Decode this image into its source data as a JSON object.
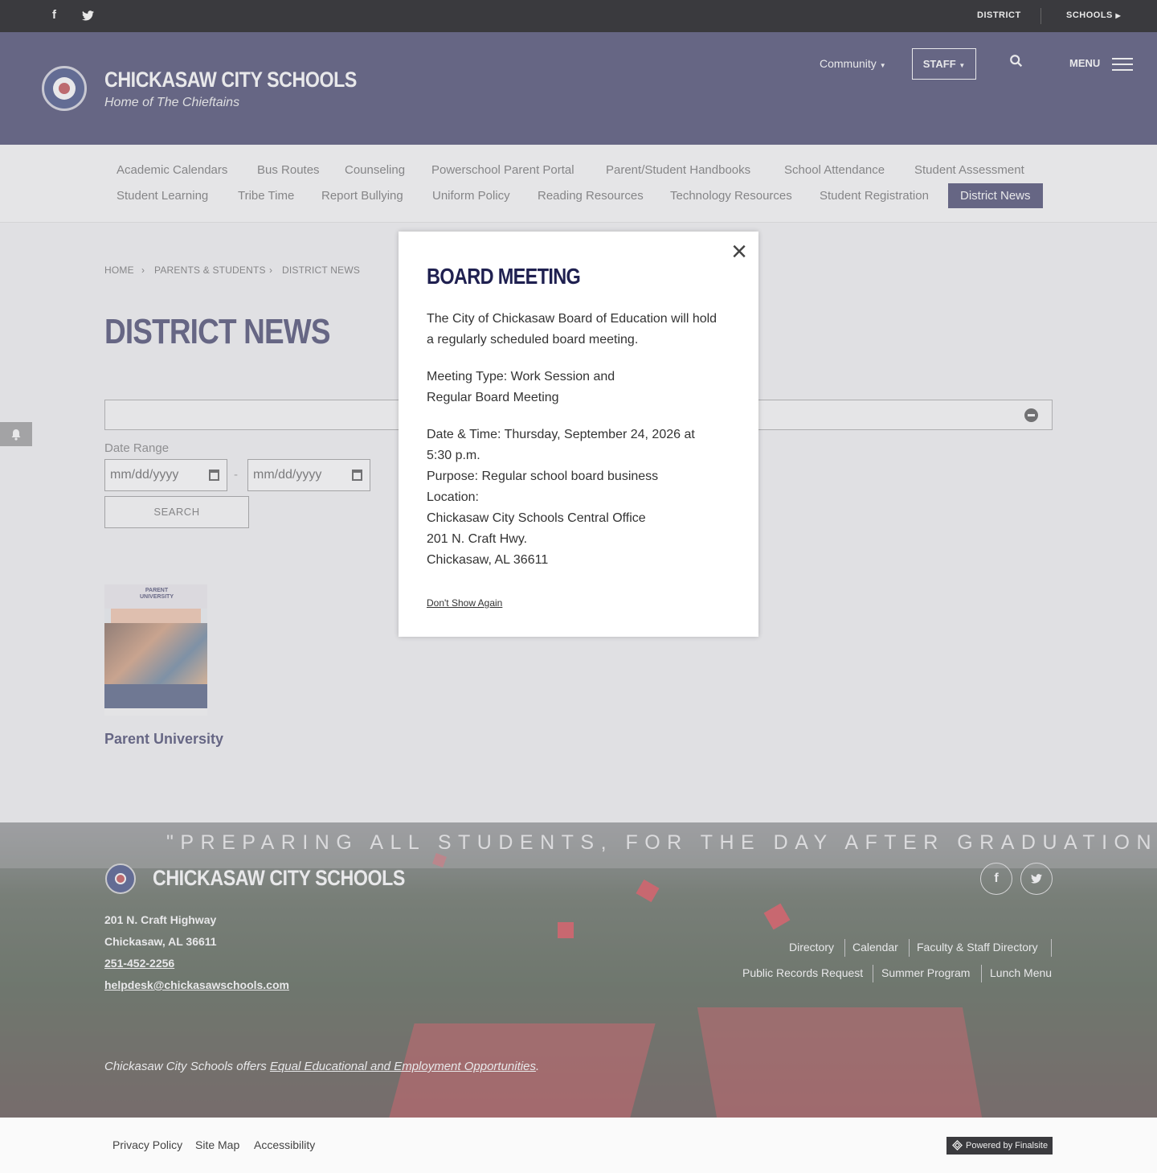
{
  "topbar": {
    "district": "DISTRICT",
    "schools": "SCHOOLS"
  },
  "header": {
    "title": "CHICKASAW CITY SCHOOLS",
    "subtitle": "Home of The Chieftains",
    "community": "Community",
    "staff": "STAFF",
    "menu": "MENU"
  },
  "subnav": [
    "Academic Calendars",
    "Bus Routes",
    "Counseling",
    "Powerschool Parent Portal",
    "Parent/Student Handbooks",
    "School Attendance",
    "Student Assessment",
    "Student Learning",
    "Tribe Time",
    "Report Bullying",
    "Uniform Policy",
    "Reading Resources",
    "Technology Resources",
    "Student Registration",
    "District News"
  ],
  "breadcrumb": [
    "HOME",
    "PARENTS & STUDENTS",
    "DISTRICT NEWS"
  ],
  "page_title": "DISTRICT NEWS",
  "filter": {
    "date_range_label": "Date Range",
    "start_placeholder": "mm/dd/yyyy",
    "end_placeholder": "mm/dd/yyyy",
    "dash": "-",
    "search": "SEARCH"
  },
  "news_item": {
    "title": "Parent University",
    "thumb_heading": "PARENT UNIVERSITY"
  },
  "modal": {
    "close": "×",
    "title": "BOARD MEETING",
    "lines": [
      "The City of Chickasaw Board of Education will hold",
      "a regularly scheduled board meeting.",
      "Meeting Type: Work Session and",
      "Regular Board Meeting",
      "Date & Time: Thursday, September 24, 2026 at",
      "5:30 p.m.",
      "Purpose: Regular school board business",
      "Location:",
      "Chickasaw City Schools Central Office",
      "201 N. Craft Hwy.",
      "Chickasaw, AL 36611"
    ],
    "dont_show": "Don't Show Again"
  },
  "footer": {
    "quote": "\"PREPARING ALL STUDENTS, FOR THE DAY AFTER GRADUATION\"",
    "name": "CHICKASAW CITY SCHOOLS",
    "address1": "201 N. Craft Highway",
    "address2": "Chickasaw, AL  36611",
    "phone": "251-452-2256",
    "email": "helpdesk@chickasawschools.com",
    "links_row1": [
      "Directory",
      "Calendar",
      "Faculty & Staff Directory"
    ],
    "links_row2": [
      "Public Records Request",
      "Summer Program",
      "Lunch Menu"
    ],
    "eeo_prefix": "Chickasaw City Schools offers ",
    "eeo_link": "Equal Educational and Employment Opportunities",
    "eeo_suffix": "."
  },
  "bottom": {
    "privacy": "Privacy Policy",
    "sitemap": "Site Map",
    "accessibility": "Accessibility",
    "powered": "Powered by Finalsite"
  },
  "colors": {
    "navy": "#1f2050",
    "topbar": "#3a3a3e",
    "accent_red": "#c8242e"
  }
}
